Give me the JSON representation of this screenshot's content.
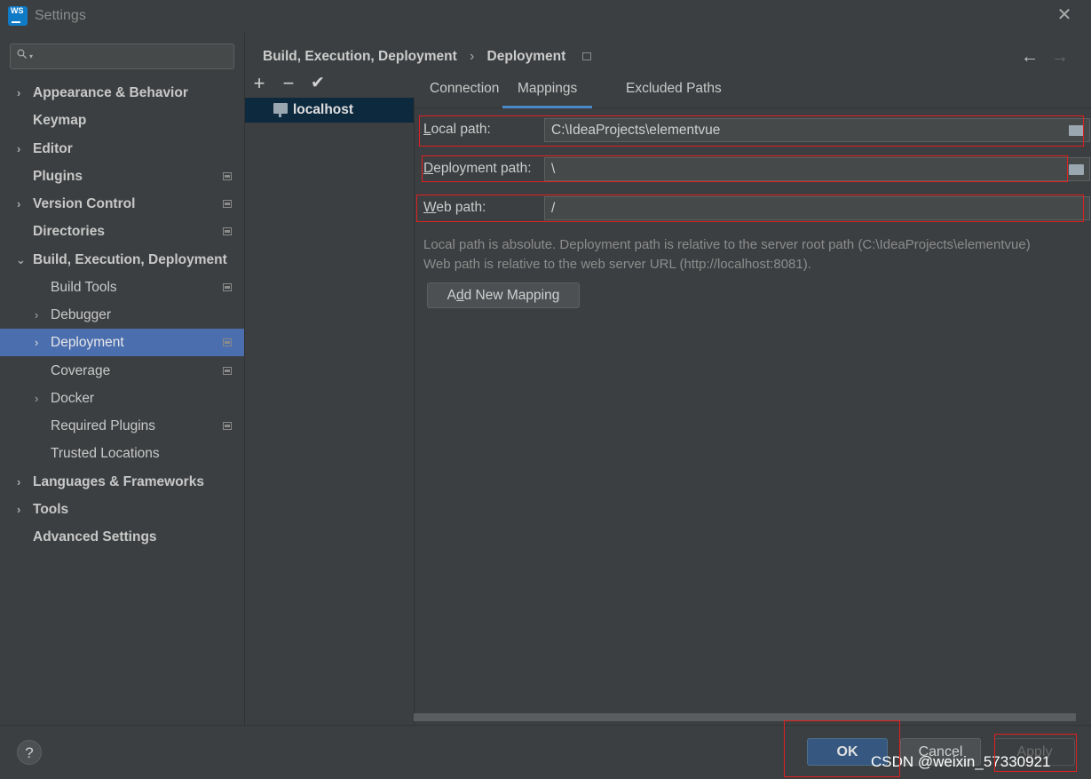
{
  "window": {
    "title": "Settings",
    "logo_text": "WS"
  },
  "sidebar": {
    "search_placeholder": "",
    "items": [
      {
        "label": "Appearance & Behavior"
      },
      {
        "label": "Keymap"
      },
      {
        "label": "Editor"
      },
      {
        "label": "Plugins"
      },
      {
        "label": "Version Control"
      },
      {
        "label": "Directories"
      },
      {
        "label": "Build, Execution, Deployment"
      },
      {
        "label": "Build Tools"
      },
      {
        "label": "Debugger"
      },
      {
        "label": "Deployment"
      },
      {
        "label": "Coverage"
      },
      {
        "label": "Docker"
      },
      {
        "label": "Required Plugins"
      },
      {
        "label": "Trusted Locations"
      },
      {
        "label": "Languages & Frameworks"
      },
      {
        "label": "Tools"
      },
      {
        "label": "Advanced Settings"
      }
    ]
  },
  "breadcrumb": {
    "parent": "Build, Execution, Deployment",
    "separator": "›",
    "current": "Deployment"
  },
  "toolbar": {
    "add": "+",
    "remove": "−",
    "check": "✔"
  },
  "servers": [
    {
      "name": "localhost"
    }
  ],
  "tabs": [
    {
      "label": "Connection"
    },
    {
      "label": "Mappings"
    },
    {
      "label": "Excluded Paths"
    }
  ],
  "form": {
    "local_path": {
      "label_mn": "L",
      "label_rest": "ocal path:",
      "value": "C:\\IdeaProjects\\elementvue"
    },
    "deployment_path": {
      "label_mn": "D",
      "label_rest": "eployment path:",
      "value": "\\"
    },
    "web_path": {
      "label_mn": "W",
      "label_rest": "eb path:",
      "value": "/"
    }
  },
  "hints": [
    "Local path is absolute. Deployment path is relative to the server root path (C:\\IdeaProjects\\elementvue)",
    "Web path is relative to the web server URL (http://localhost:8081)."
  ],
  "add_mapping": {
    "pre": "A",
    "mn": "d",
    "post": "d New Mapping"
  },
  "footer": {
    "help": "?",
    "ok": "OK",
    "cancel": "Cancel",
    "apply": "Apply",
    "watermark": "CSDN @weixin_57330921"
  },
  "colors": {
    "selection": "#4b6eaf",
    "ok_button": "#365880",
    "annotation_box": "#e02020",
    "active_tab": "#4a88c7"
  }
}
